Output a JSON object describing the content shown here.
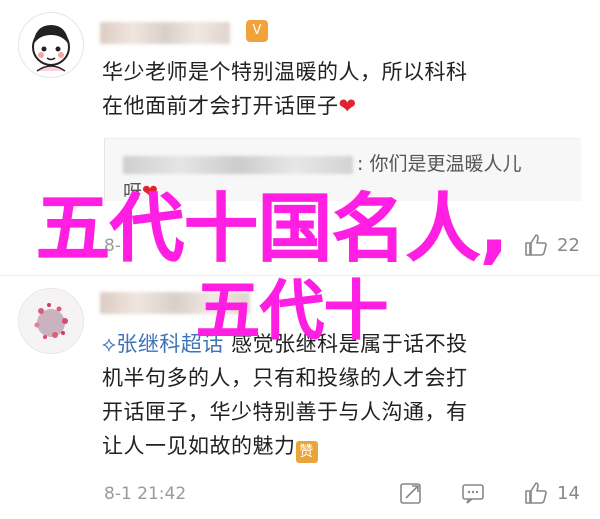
{
  "comment1": {
    "badge_glyph": "V",
    "text_line1": "华少老师是个特别温暖的人，所以科科",
    "text_line2": "在他面前才会打开话匣子",
    "quote_text": ": 你们是更温暖人儿",
    "quote_line2": "呀",
    "time": "8-1",
    "likes": "22"
  },
  "comment2": {
    "topic": "张继科超话",
    "text_line1_rest": "感觉张继科是属于话不投",
    "text_line2": "机半句多的人，只有和投缘的人才会打",
    "text_line3": "开话匣子，华少特别善于与人沟通，有",
    "text_line4": "让人一见如故的魅力",
    "emoji_label": "赞",
    "time": "8-1 21:42",
    "likes": "14"
  },
  "overlay": {
    "line1": "五代十国名人,",
    "line2": "五代十"
  },
  "icons": {
    "share": "share-icon",
    "comment": "comment-icon",
    "like": "thumbs-up-icon",
    "heart": "heart-icon"
  },
  "colors": {
    "overlay_text": "#ff1fe2",
    "topic_link": "#3f73b8",
    "heart": "#e0242f",
    "meta": "#9a9a9a"
  }
}
